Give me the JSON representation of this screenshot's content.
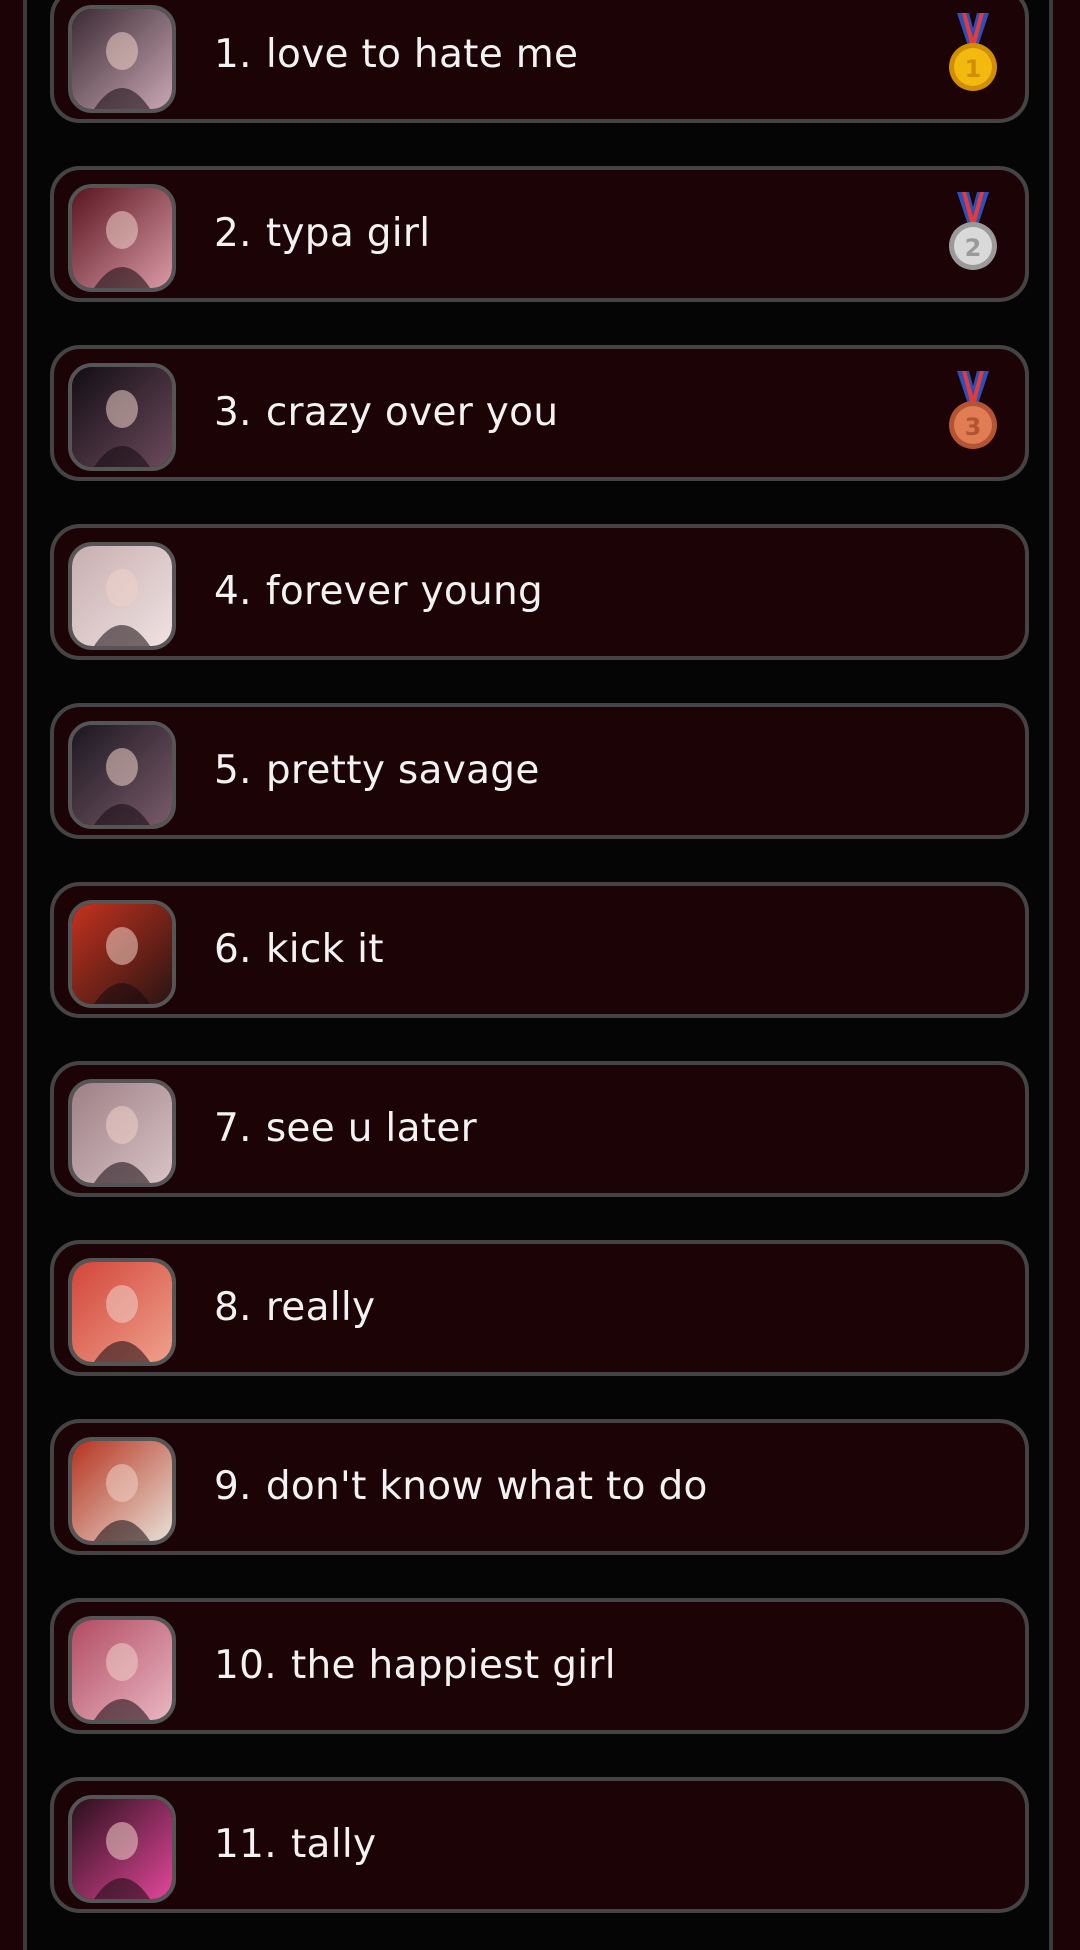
{
  "tracks": [
    {
      "rank": "1.",
      "title": "love to hate me",
      "medal": "gold-medal-icon",
      "thumb_colors": [
        "#3a2a33",
        "#c9a7b4"
      ]
    },
    {
      "rank": "2.",
      "title": "typa girl",
      "medal": "silver-medal-icon",
      "thumb_colors": [
        "#5a1520",
        "#d99aa6"
      ]
    },
    {
      "rank": "3.",
      "title": "crazy over you",
      "medal": "bronze-medal-icon",
      "thumb_colors": [
        "#120d14",
        "#6b4a5c"
      ]
    },
    {
      "rank": "4.",
      "title": "forever young",
      "medal": null,
      "thumb_colors": [
        "#c8aeb1",
        "#efe2e2"
      ]
    },
    {
      "rank": "5.",
      "title": "pretty savage",
      "medal": null,
      "thumb_colors": [
        "#1b1720",
        "#7a5b6a"
      ]
    },
    {
      "rank": "6.",
      "title": "kick it",
      "medal": null,
      "thumb_colors": [
        "#c4321f",
        "#2a1412"
      ]
    },
    {
      "rank": "7.",
      "title": "see u later",
      "medal": null,
      "thumb_colors": [
        "#9e7f86",
        "#d8c3c6"
      ]
    },
    {
      "rank": "8.",
      "title": "really",
      "medal": null,
      "thumb_colors": [
        "#d2463a",
        "#efa08c"
      ]
    },
    {
      "rank": "9.",
      "title": "don't know what to do",
      "medal": null,
      "thumb_colors": [
        "#b6331f",
        "#e8e0d6"
      ]
    },
    {
      "rank": "10.",
      "title": "the happiest girl",
      "medal": null,
      "thumb_colors": [
        "#b24b63",
        "#e9b7c2"
      ]
    },
    {
      "rank": "11.",
      "title": "tally",
      "medal": null,
      "thumb_colors": [
        "#2a0f1b",
        "#e2479a"
      ]
    }
  ],
  "colors": {
    "row_bg": "#1c0306",
    "row_border": "#444444",
    "page_bg": "#050505",
    "text": "#f2f2f2",
    "gold": "#f2b90f",
    "silver": "#c9c9c9",
    "bronze": "#d26f4a"
  }
}
